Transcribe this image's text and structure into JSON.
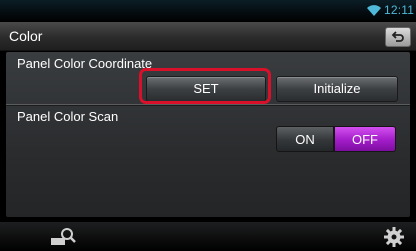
{
  "status": {
    "time": "12:11",
    "wifi_icon": "wifi-icon"
  },
  "header": {
    "title": "Color",
    "back_icon": "return-icon"
  },
  "rows": {
    "coordinate": {
      "label": "Panel Color Coordinate",
      "set_label": "SET",
      "initialize_label": "Initialize"
    },
    "scan": {
      "label": "Panel Color Scan",
      "on_label": "ON",
      "off_label": "OFF",
      "selected": "OFF"
    }
  },
  "footer": {
    "left_icon": "search-icon",
    "right_icon": "gear-icon"
  },
  "colors": {
    "accent": "#4fb8d8",
    "toggle_selected": "#b227d8",
    "highlight": "#d8102a"
  }
}
